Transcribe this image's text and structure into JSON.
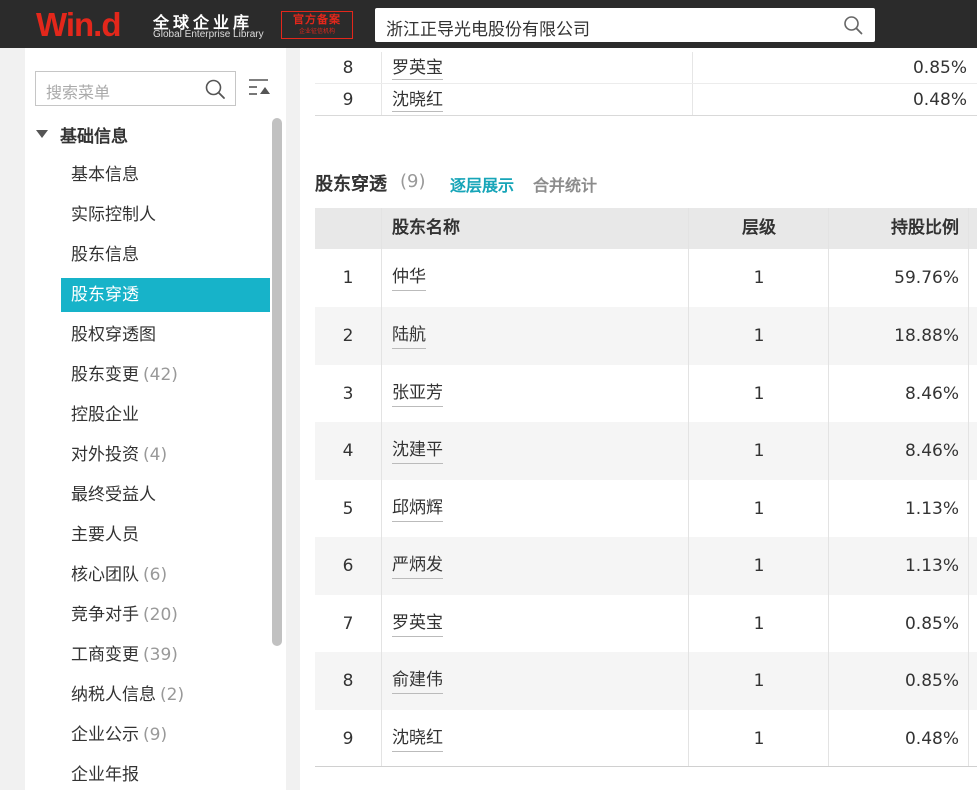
{
  "header": {
    "logo_text": "Win.d",
    "logo_cn": "全球企业库",
    "logo_en": "Global Enterprise Library",
    "badge_main": "官方备案",
    "badge_sub": "企业征信机构",
    "search_value": "浙江正导光电股份有限公司",
    "brand_color": "#e3271b"
  },
  "sidebar": {
    "search_placeholder": "搜索菜单",
    "group_title": "基础信息",
    "items": [
      {
        "label": "基本信息",
        "count": ""
      },
      {
        "label": "实际控制人",
        "count": ""
      },
      {
        "label": "股东信息",
        "count": ""
      },
      {
        "label": "股东穿透",
        "count": "",
        "active": true
      },
      {
        "label": "股权穿透图",
        "count": ""
      },
      {
        "label": "股东变更",
        "count": "(42)"
      },
      {
        "label": "控股企业",
        "count": ""
      },
      {
        "label": "对外投资",
        "count": "(4)"
      },
      {
        "label": "最终受益人",
        "count": ""
      },
      {
        "label": "主要人员",
        "count": ""
      },
      {
        "label": "核心团队",
        "count": "(6)"
      },
      {
        "label": "竞争对手",
        "count": "(20)"
      },
      {
        "label": "工商变更",
        "count": "(39)"
      },
      {
        "label": "纳税人信息",
        "count": "(2)"
      },
      {
        "label": "企业公示",
        "count": "(9)"
      },
      {
        "label": "企业年报",
        "count": ""
      }
    ],
    "active_color": "#17b3c9"
  },
  "top_table": {
    "rows": [
      {
        "num": "8",
        "name": "罗英宝",
        "pct": "0.85%"
      },
      {
        "num": "9",
        "name": "沈晓红",
        "pct": "0.48%"
      }
    ]
  },
  "section": {
    "title": "股东穿透",
    "count": "(9)",
    "tab_layer": "逐层展示",
    "tab_merge": "合并统计",
    "tab_active_color": "#17a5b8"
  },
  "table": {
    "headers": {
      "name": "股东名称",
      "level": "层级",
      "pct": "持股比例"
    },
    "rows": [
      {
        "num": "1",
        "name": "仲华",
        "level": "1",
        "pct": "59.76%"
      },
      {
        "num": "2",
        "name": "陆航",
        "level": "1",
        "pct": "18.88%"
      },
      {
        "num": "3",
        "name": "张亚芳",
        "level": "1",
        "pct": "8.46%"
      },
      {
        "num": "4",
        "name": "沈建平",
        "level": "1",
        "pct": "8.46%"
      },
      {
        "num": "5",
        "name": "邱炳辉",
        "level": "1",
        "pct": "1.13%"
      },
      {
        "num": "6",
        "name": "严炳发",
        "level": "1",
        "pct": "1.13%"
      },
      {
        "num": "7",
        "name": "罗英宝",
        "level": "1",
        "pct": "0.85%"
      },
      {
        "num": "8",
        "name": "俞建伟",
        "level": "1",
        "pct": "0.85%"
      },
      {
        "num": "9",
        "name": "沈晓红",
        "level": "1",
        "pct": "0.48%"
      }
    ]
  }
}
